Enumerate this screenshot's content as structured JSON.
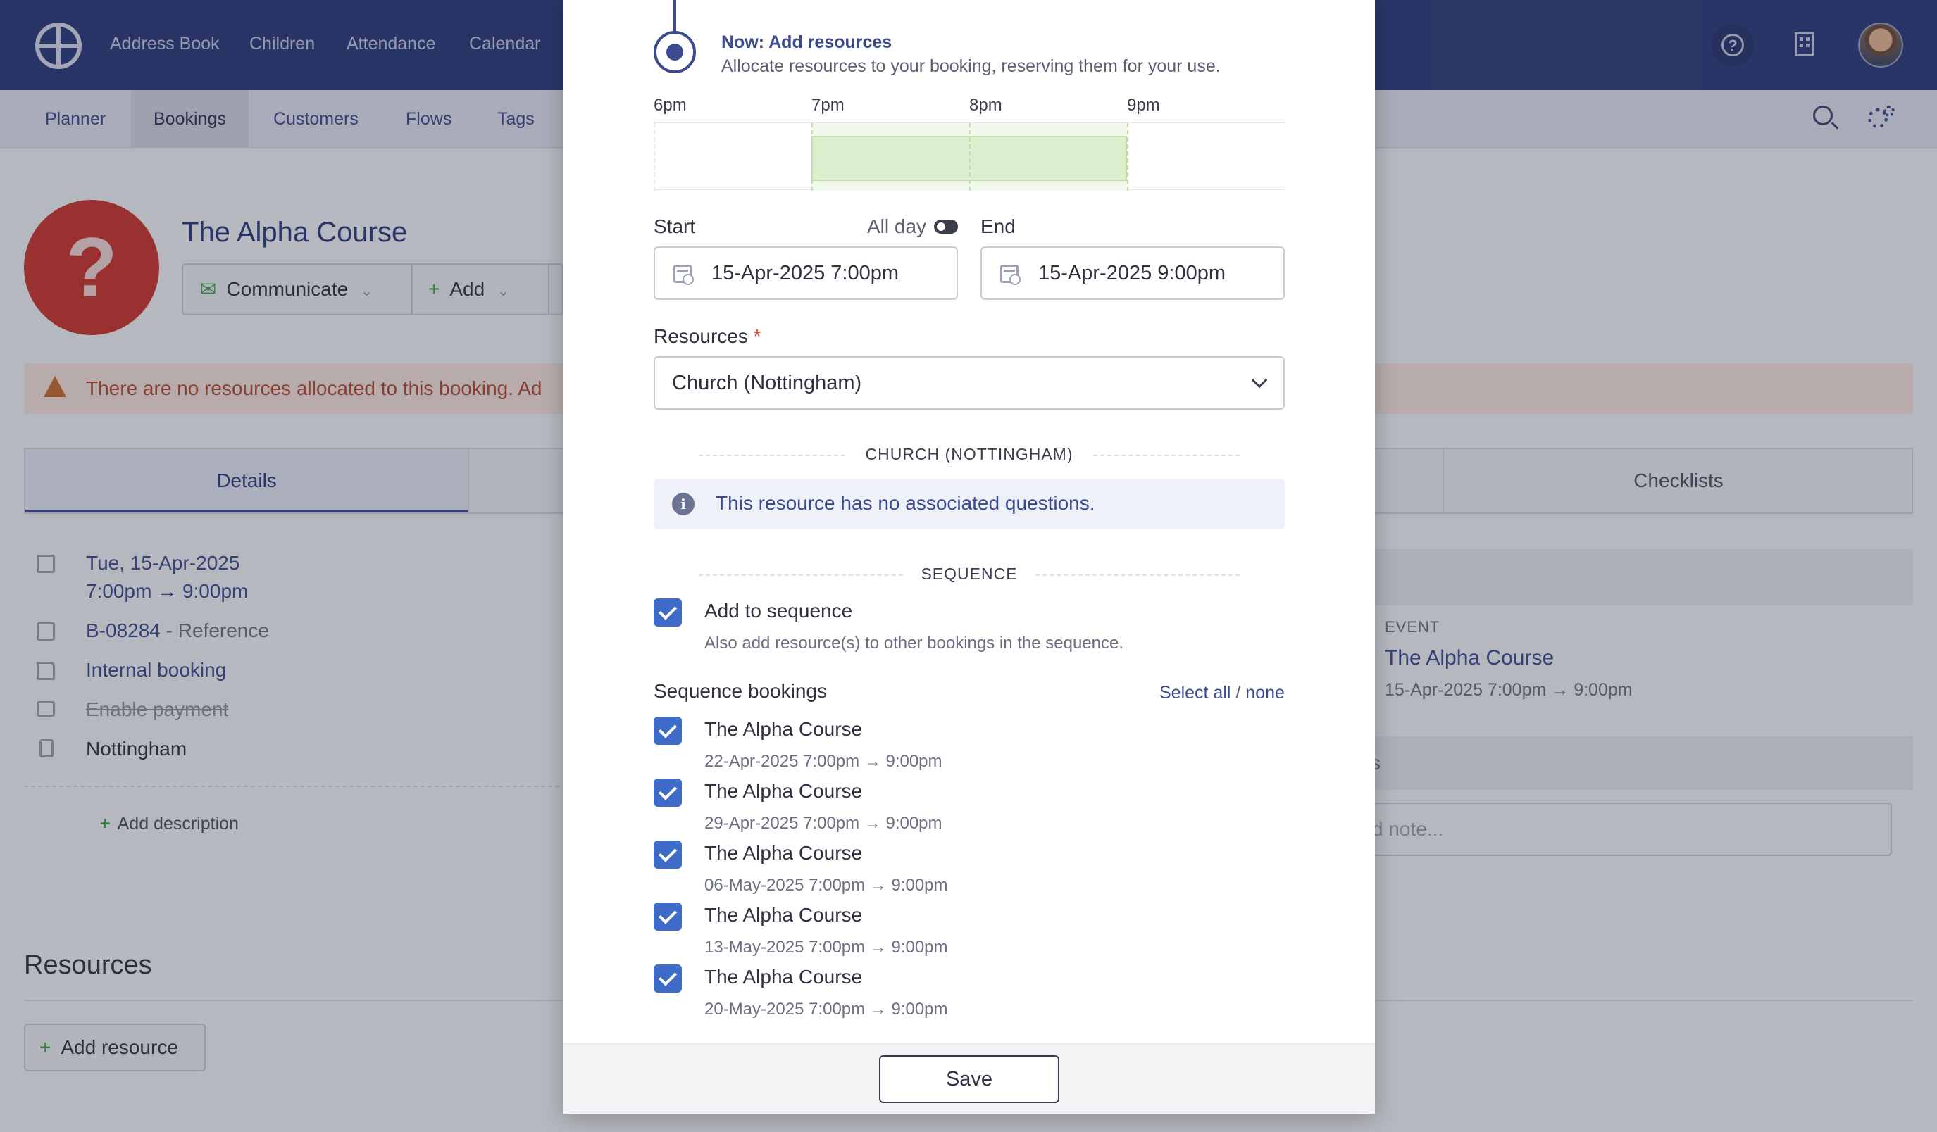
{
  "topnav": {
    "links": [
      "Address Book",
      "Children",
      "Attendance",
      "Calendar"
    ]
  },
  "subnav": {
    "tabs": [
      "Planner",
      "Bookings",
      "Customers",
      "Flows",
      "Tags"
    ],
    "active_tab": "Bookings"
  },
  "booking": {
    "title": "The Alpha Course",
    "communicate_label": "Communicate",
    "add_label": "Add",
    "alert": "There are no resources allocated to this booking. Ad",
    "tabs": [
      "Details",
      "Checklists"
    ],
    "date": "Tue, 15-Apr-2025",
    "time": "7:00pm → 9:00pm",
    "reference_code": "B-08284",
    "reference_label": " - Reference",
    "booking_type": "Internal booking",
    "payment": "Enable payment",
    "location": "Nottingham",
    "add_description": "Add description",
    "resources_heading": "Resources",
    "add_resource": "Add resource",
    "event_label": "EVENT",
    "event_title": "The Alpha Course",
    "event_time": "15-Apr-2025 7:00pm → 9:00pm",
    "notes_partial": "s",
    "note_placeholder_partial": "d note..."
  },
  "modal": {
    "step_title": "Now: Add resources",
    "step_subtitle": "Allocate resources to your booking, reserving them for your use.",
    "timeline_labels": [
      "6pm",
      "7pm",
      "8pm",
      "9pm"
    ],
    "start_label": "Start",
    "allday_label": "All day",
    "end_label": "End",
    "start_value": "15-Apr-2025 7:00pm",
    "end_value": "15-Apr-2025 9:00pm",
    "resources_label": "Resources",
    "required_mark": "*",
    "resource_selected": "Church (Nottingham)",
    "resource_section_heading": "CHURCH (NOTTINGHAM)",
    "resource_info": "This resource has no associated questions.",
    "sequence_heading": "SEQUENCE",
    "add_to_sequence_label": "Add to sequence",
    "add_to_sequence_help": "Also add resource(s) to other bookings in the sequence.",
    "sequence_bookings_label": "Sequence bookings",
    "select_all": "Select all",
    "select_separator": " / ",
    "select_none": "none",
    "sequence_items": [
      {
        "title": "The Alpha Course",
        "time": "22-Apr-2025 7:00pm → 9:00pm",
        "checked": true
      },
      {
        "title": "The Alpha Course",
        "time": "29-Apr-2025 7:00pm → 9:00pm",
        "checked": true
      },
      {
        "title": "The Alpha Course",
        "time": "06-May-2025 7:00pm → 9:00pm",
        "checked": true
      },
      {
        "title": "The Alpha Course",
        "time": "13-May-2025 7:00pm → 9:00pm",
        "checked": true
      },
      {
        "title": "The Alpha Course",
        "time": "20-May-2025 7:00pm → 9:00pm",
        "checked": true
      }
    ],
    "save_label": "Save"
  },
  "colors": {
    "nav_bg": "#2c3a7a",
    "accent": "#3c4a8f",
    "checkbox": "#3e6bc8",
    "timeline_block": "#dbefcf",
    "avatar_red": "#c9342c"
  },
  "icons": [
    "logo-icon",
    "help-icon",
    "building-icon",
    "user-avatar",
    "search-icon",
    "settings-gear-icon",
    "calendar-icon",
    "info-icon",
    "chevron-down-icon",
    "warning-icon",
    "checkbox-check-icon"
  ]
}
